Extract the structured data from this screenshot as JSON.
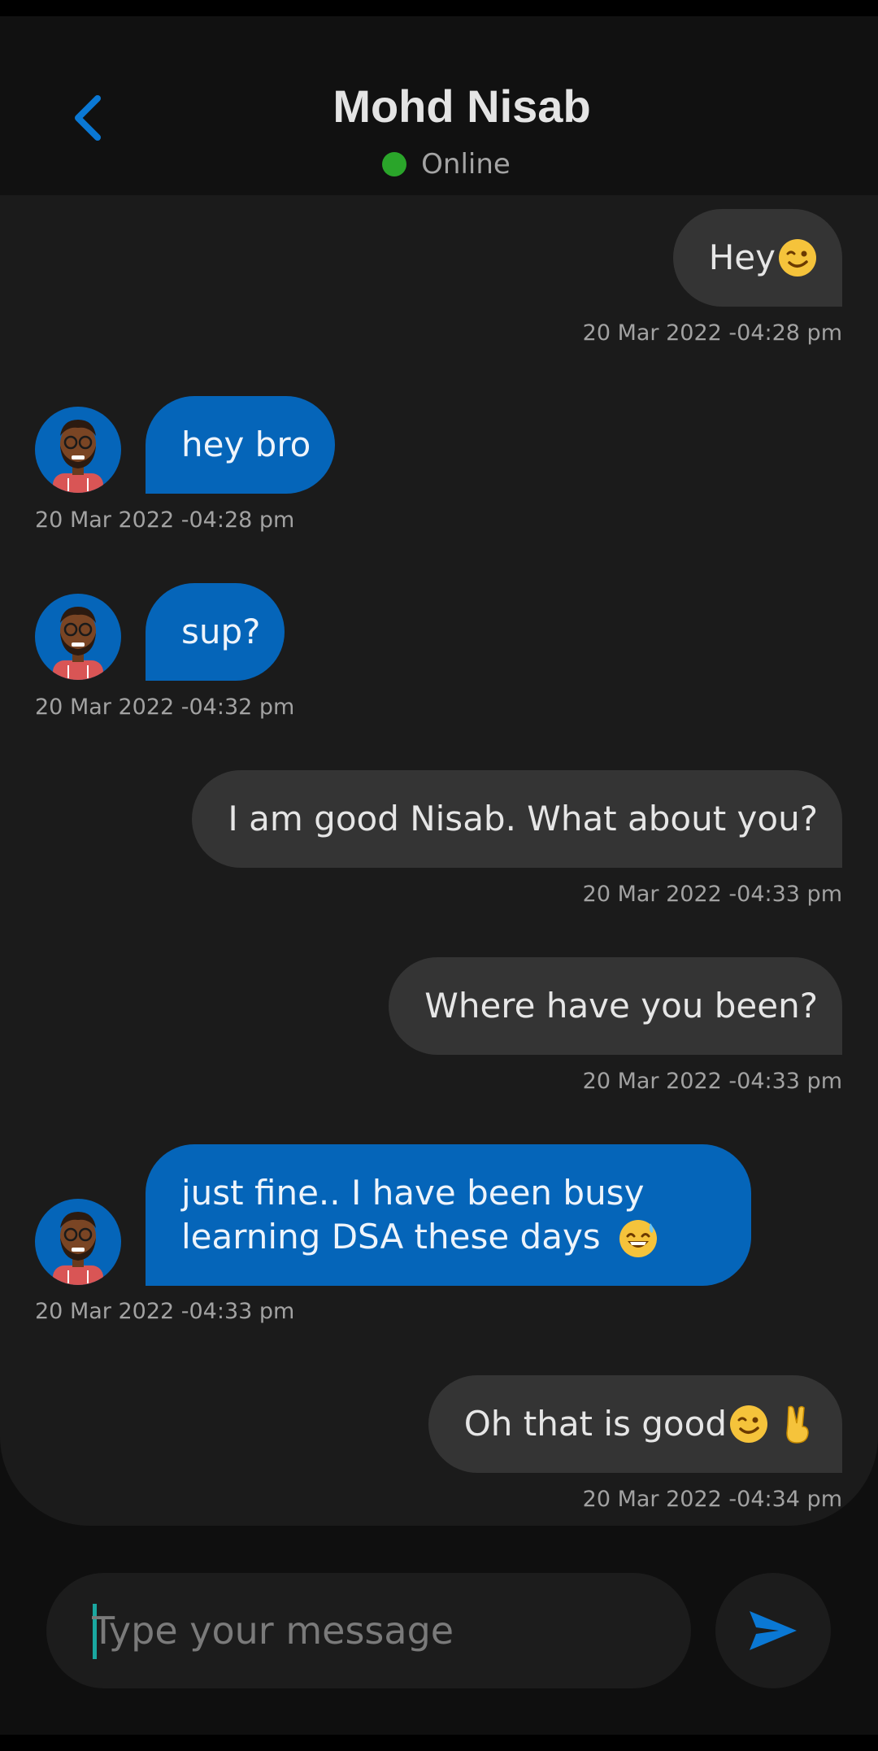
{
  "header": {
    "title": "Mohd Nisab",
    "status": "Online",
    "status_color": "#2aa52a",
    "back_icon": "chevron-left-icon"
  },
  "messages": [
    {
      "direction": "sent",
      "text": "Hey",
      "emoji": "winking-face",
      "timestamp": "20 Mar 2022 -04:28 pm"
    },
    {
      "direction": "received",
      "text": "hey bro",
      "timestamp": "20 Mar 2022 -04:28 pm"
    },
    {
      "direction": "received",
      "text": "sup?",
      "timestamp": "20 Mar 2022 -04:32 pm"
    },
    {
      "direction": "sent",
      "text": "I am good Nisab. What about you?",
      "timestamp": "20 Mar 2022 -04:33 pm"
    },
    {
      "direction": "sent",
      "text": "Where have you been?",
      "timestamp": "20 Mar 2022 -04:33 pm"
    },
    {
      "direction": "received",
      "text_line1": "just fine.. I have been busy",
      "text_line2": "learning DSA these days",
      "emoji": "grinning-face-with-sweat",
      "timestamp": "20 Mar 2022 -04:33 pm"
    },
    {
      "direction": "sent",
      "text": "Oh that is good",
      "emoji": "winking-face, victory-hand",
      "timestamp": "20 Mar 2022 -04:34 pm"
    }
  ],
  "composer": {
    "placeholder": "Type your message",
    "value": "",
    "send_icon": "send-icon"
  },
  "colors": {
    "accent": "#0565b9",
    "sent_bubble": "#343434",
    "chat_background": "#1b1b1b"
  }
}
